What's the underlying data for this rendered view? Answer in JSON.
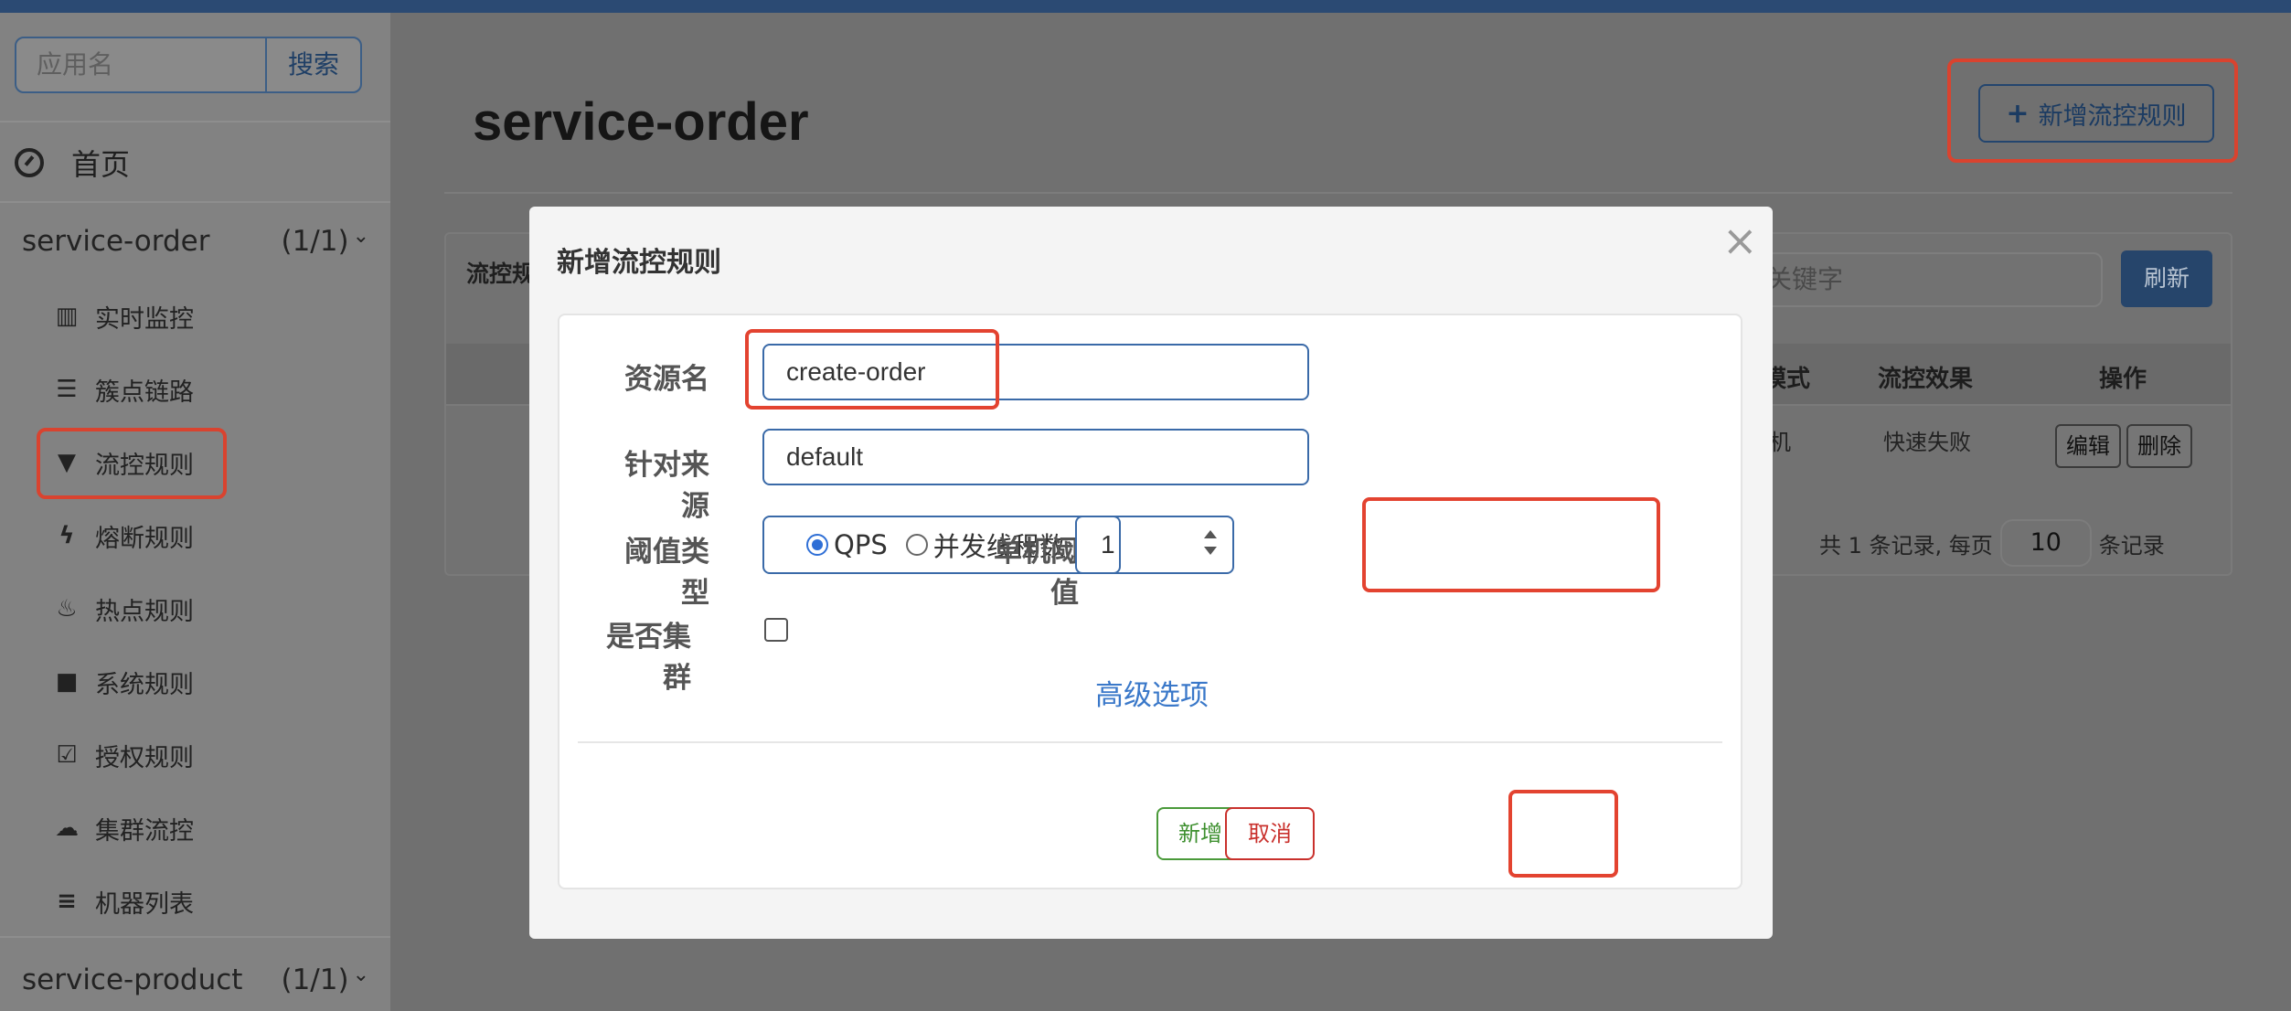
{
  "sidebar": {
    "search_placeholder": "应用名",
    "search_button": "搜索",
    "home_label": "首页",
    "apps": [
      {
        "name": "service-order",
        "count": "(1/1)"
      },
      {
        "name": "service-product",
        "count": "(1/1)"
      }
    ],
    "menu": [
      {
        "label": "实时监控",
        "icon": "bar-chart-icon"
      },
      {
        "label": "簇点链路",
        "icon": "list-box-icon"
      },
      {
        "label": "流控规则",
        "icon": "filter-icon"
      },
      {
        "label": "熔断规则",
        "icon": "bolt-icon"
      },
      {
        "label": "热点规则",
        "icon": "fire-icon"
      },
      {
        "label": "系统规则",
        "icon": "lock-icon"
      },
      {
        "label": "授权规则",
        "icon": "check-square-icon"
      },
      {
        "label": "集群流控",
        "icon": "cloud-icon"
      },
      {
        "label": "机器列表",
        "icon": "list-icon"
      }
    ]
  },
  "main": {
    "title": "service-order",
    "add_rule_button": "新增流控规则",
    "panel_title": "流控规",
    "keyword_placeholder": "关键字",
    "refresh_button": "刷新",
    "table_headers": [
      "模式",
      "流控效果",
      "操作"
    ],
    "row": {
      "mode": "机",
      "effect": "快速失败",
      "edit": "编辑",
      "delete": "删除"
    },
    "pager": {
      "prefix": "共 1 条记录, 每页",
      "page_size": "10",
      "suffix": "条记录"
    }
  },
  "modal": {
    "title": "新增流控规则",
    "close_glyph": "×",
    "resource_label": "资源名",
    "resource_value": "create-order",
    "origin_label": "针对来源",
    "origin_value": "default",
    "threshold_type_label": "阈值类型",
    "threshold_options": [
      "QPS",
      "并发线程数"
    ],
    "selected_threshold_type": "QPS",
    "single_threshold_label": "单机阈值",
    "single_threshold_value": "1",
    "cluster_label": "是否集群",
    "cluster_checked": false,
    "advanced_link": "高级选项",
    "add_button": "新增",
    "cancel_button": "取消"
  },
  "colors": {
    "highlight": "#e34330",
    "primary_blue": "#3a6aa8",
    "add_green": "#3d8f2e",
    "cancel_red": "#c9302c"
  }
}
